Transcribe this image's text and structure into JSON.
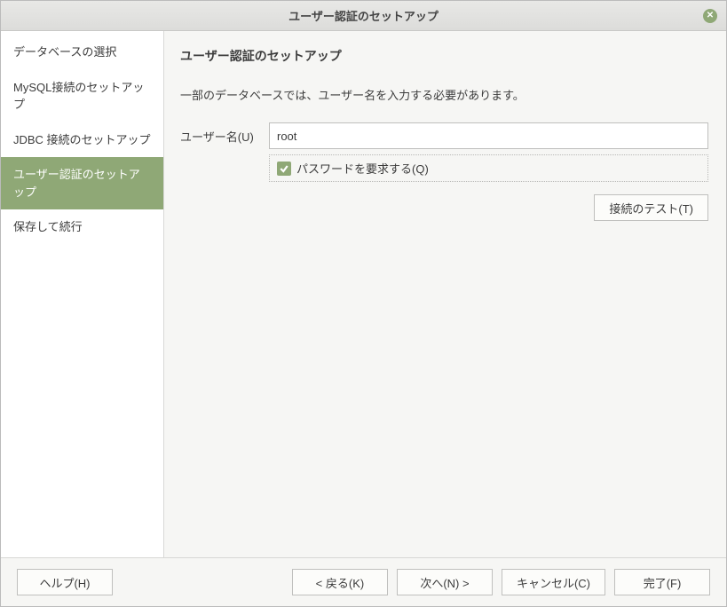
{
  "titlebar": {
    "title": "ユーザー認証のセットアップ"
  },
  "sidebar": {
    "items": [
      {
        "label": "データベースの選択",
        "active": false
      },
      {
        "label": "MySQL接続のセットアップ",
        "active": false
      },
      {
        "label": "JDBC 接続のセットアップ",
        "active": false
      },
      {
        "label": "ユーザー認証のセットアップ",
        "active": true
      },
      {
        "label": "保存して続行",
        "active": false
      }
    ]
  },
  "main": {
    "page_title": "ユーザー認証のセットアップ",
    "description": "一部のデータベースでは、ユーザー名を入力する必要があります。",
    "username_label": "ユーザー名(U)",
    "username_value": "root",
    "password_checkbox_label": "パスワードを要求する(Q)",
    "password_checkbox_checked": true,
    "test_button": "接続のテスト(T)"
  },
  "footer": {
    "help": "ヘルプ(H)",
    "back": "< 戻る(K)",
    "next": "次へ(N) >",
    "cancel": "キャンセル(C)",
    "finish": "完了(F)"
  }
}
